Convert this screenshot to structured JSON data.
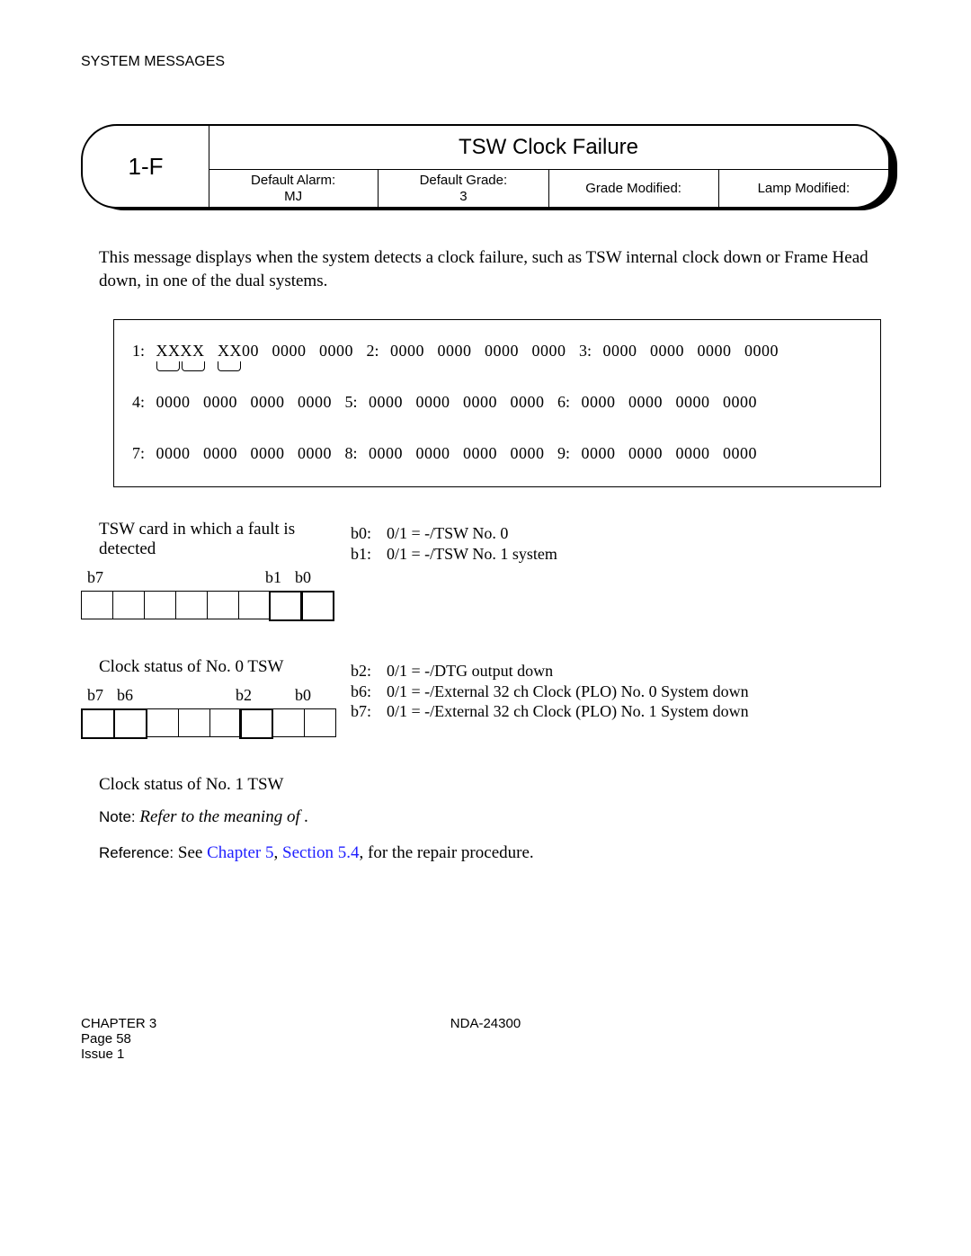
{
  "header": "SYSTEM MESSAGES",
  "titleBox": {
    "code": "1-F",
    "title": "TSW Clock Failure",
    "cells": {
      "c1l1": "Default Alarm:",
      "c1l2": "MJ",
      "c2l1": "Default Grade:",
      "c2l2": "3",
      "c3l1": "Grade Modified:",
      "c4l1": "Lamp Modified:"
    }
  },
  "bodyText": "This message displays when the system detects a clock failure, such as TSW internal clock down or Frame Head down, in one of the dual systems.",
  "data": {
    "r1_1": "1:",
    "r1_xxxx": "XXXX",
    "r1_xx00": "XX00",
    "g0000": "0000",
    "r1_2": "2:",
    "r1_3": "3:",
    "r2_4": "4:",
    "r2_5": "5:",
    "r2_6": "6:",
    "r3_7": "7:",
    "r3_8": "8:",
    "r3_9": "9:"
  },
  "sec1": {
    "label": "TSW card in which a fault is detected",
    "bits": {
      "b7": "b7",
      "b1": "b1",
      "b0": "b0"
    },
    "defs": {
      "b0lab": "b0:",
      "b0val": "0/1 = -/TSW No. 0",
      "b1lab": "b1:",
      "b1val": "0/1 = -/TSW No. 1 system"
    }
  },
  "sec2": {
    "label": "Clock status of No. 0 TSW",
    "bits": {
      "b7": "b7",
      "b6": "b6",
      "b2": "b2",
      "b0": "b0"
    },
    "defs": {
      "b2lab": "b2:",
      "b2val": "0/1 = -/DTG output down",
      "b6lab": "b6:",
      "b6val": "0/1 = -/External 32 ch Clock (PLO) No. 0 System down",
      "b7lab": "b7:",
      "b7val": "0/1 = -/External 32 ch Clock (PLO) No. 1 System down"
    }
  },
  "sec3": {
    "label": "Clock status of No. 1 TSW"
  },
  "note": {
    "word": "Note:",
    "text": "Refer to the meaning of ",
    "tail": "."
  },
  "reference": {
    "word": "Reference:",
    "t1": "See ",
    "link1": "Chapter 5",
    "sep": ", ",
    "link2": "Section 5.4",
    "t2": ", for the repair procedure."
  },
  "footer": {
    "chapter": "CHAPTER 3",
    "page": "Page 58",
    "issue": "Issue 1",
    "doc": "NDA-24300"
  }
}
